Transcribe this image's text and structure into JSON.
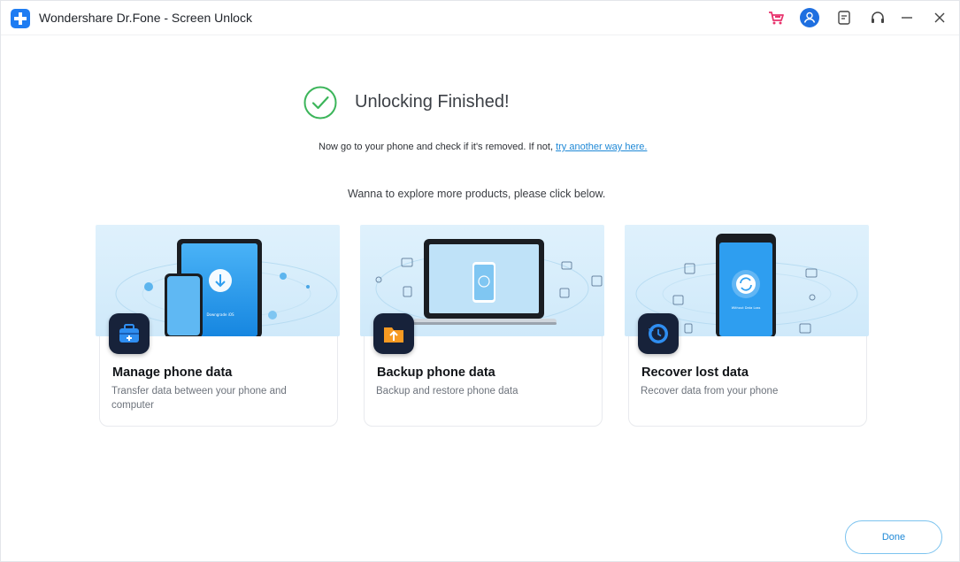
{
  "window": {
    "title": "Wondershare Dr.Fone - Screen Unlock"
  },
  "titlebar_icons": [
    "cart-icon",
    "account-icon",
    "feedback-icon",
    "support-icon",
    "minimize-icon",
    "close-icon"
  ],
  "result": {
    "title": "Unlocking Finished!",
    "hint_prefix": "Now go to your phone and check if it's removed. If not, ",
    "hint_link": "try another way here.",
    "explore_text": "Wanna to explore more products,  please click below."
  },
  "cards": [
    {
      "title": "Manage phone data",
      "desc": "Transfer data between your phone and computer",
      "badge_icon": "toolbox-icon"
    },
    {
      "title": "Backup phone data",
      "desc": "Backup and restore phone data",
      "badge_icon": "folder-upload-icon"
    },
    {
      "title": "Recover lost data",
      "desc": "Recover data from your phone",
      "badge_icon": "restore-clock-icon"
    }
  ],
  "illustrations": {
    "tablet_caption": "Downgrade iOS",
    "recover_caption": "Without Data Loss"
  },
  "footer": {
    "done_label": "Done"
  },
  "colors": {
    "accent": "#1e88d6",
    "success": "#3cb55a",
    "brand": "#1e7cf2",
    "cart": "#e8336d"
  }
}
